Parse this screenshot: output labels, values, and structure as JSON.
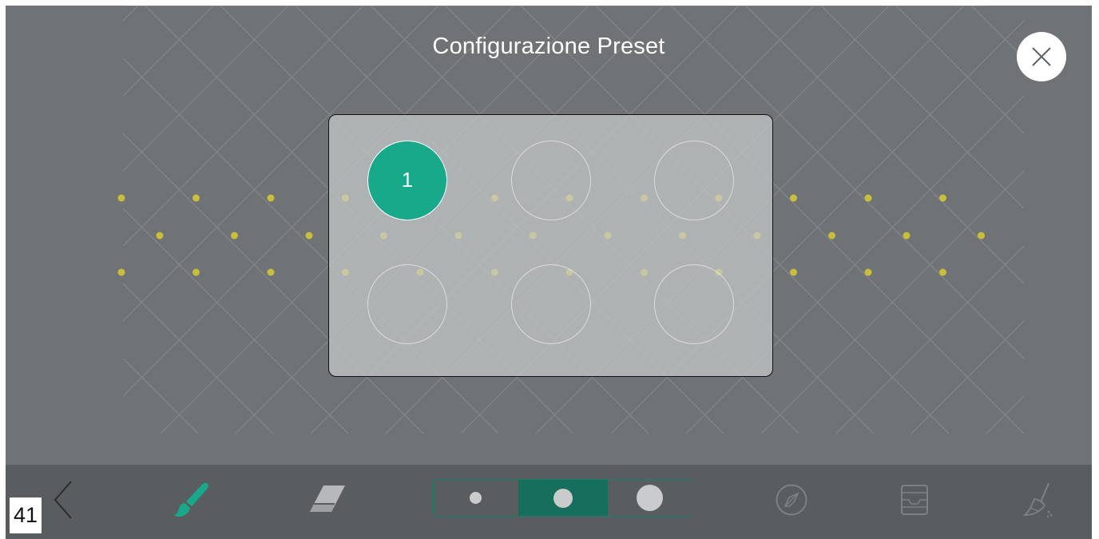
{
  "header": {
    "title": "Configurazione Preset"
  },
  "close_button": {
    "icon": "close-icon"
  },
  "preset_slots": [
    {
      "label": "1",
      "active": true
    },
    {
      "label": "",
      "active": false
    },
    {
      "label": "",
      "active": false
    },
    {
      "label": "",
      "active": false
    },
    {
      "label": "",
      "active": false
    },
    {
      "label": "",
      "active": false
    }
  ],
  "toolbar": {
    "back_icon": "chevron-left-icon",
    "brush_icon": "brush-icon",
    "eraser_icon": "eraser-icon",
    "brush_sizes": [
      "small",
      "medium",
      "large"
    ],
    "selected_brush_size": "medium",
    "compass_icon": "compass-icon",
    "tray_icon": "inbox-tray-icon",
    "broom_icon": "broom-icon"
  },
  "page_number": "41",
  "colors": {
    "background": "#6f7376",
    "toolbar": "#5a5d5f",
    "accent": "#17a98a",
    "accent_dark": "#166e5c",
    "pattern_dot": "#c8be3c",
    "panel_border": "#111111"
  }
}
